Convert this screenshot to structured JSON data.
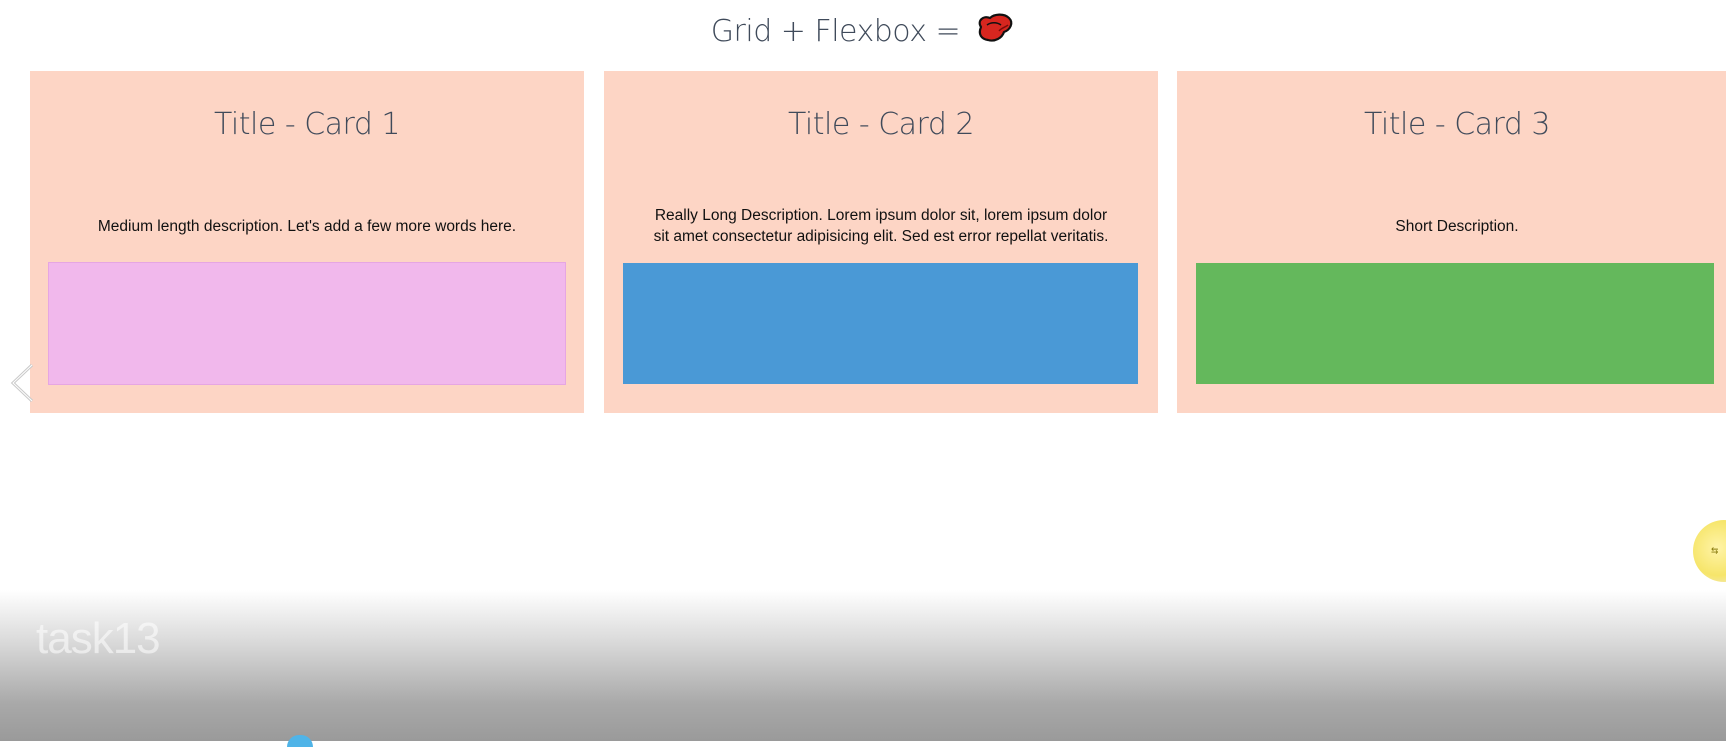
{
  "header": {
    "title": "Grid + Flexbox =",
    "heart_icon": "heart-icon"
  },
  "cards": [
    {
      "title": "Title - Card 1",
      "description": "Medium length description. Let's add a few more words here.",
      "swatch_color": "#f1b8ec"
    },
    {
      "title": "Title - Card 2",
      "description": "Really Long Description. Lorem ipsum dolor sit, lorem ipsum dolor sit amet consectetur adipisicing elit. Sed est error repellat veritatis.",
      "swatch_color": "#4a99d6"
    },
    {
      "title": "Title - Card 3",
      "description": "Short Description.",
      "swatch_color": "#64b85c"
    }
  ],
  "colors": {
    "card_background": "#fdd5c5",
    "title_text": "#3f4a5a"
  },
  "navigation": {
    "prev_icon": "chevron-left-icon"
  },
  "overlay": {
    "bubble_icon": "swap-arrows-icon",
    "bubble_glyph": "⇆"
  },
  "footer": {
    "task_label": "task13"
  }
}
